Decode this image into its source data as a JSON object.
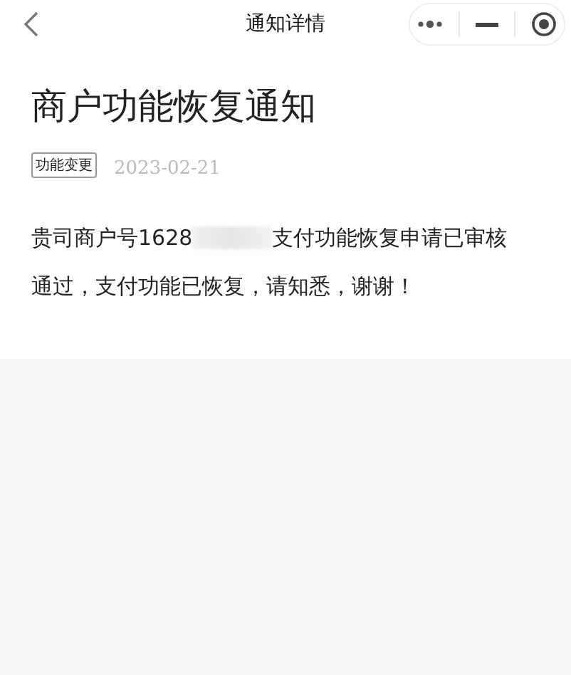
{
  "nav_bar": {
    "title": "通知详情"
  },
  "notice": {
    "title": "商户功能恢复通知",
    "tag": "功能变更",
    "date": "2023-02-21",
    "body_before": "贵司商户号1628",
    "body_after": "支付功能恢复申请已审核",
    "body_line_2": "通过，支付功能已恢复，请知悉，谢谢！"
  }
}
